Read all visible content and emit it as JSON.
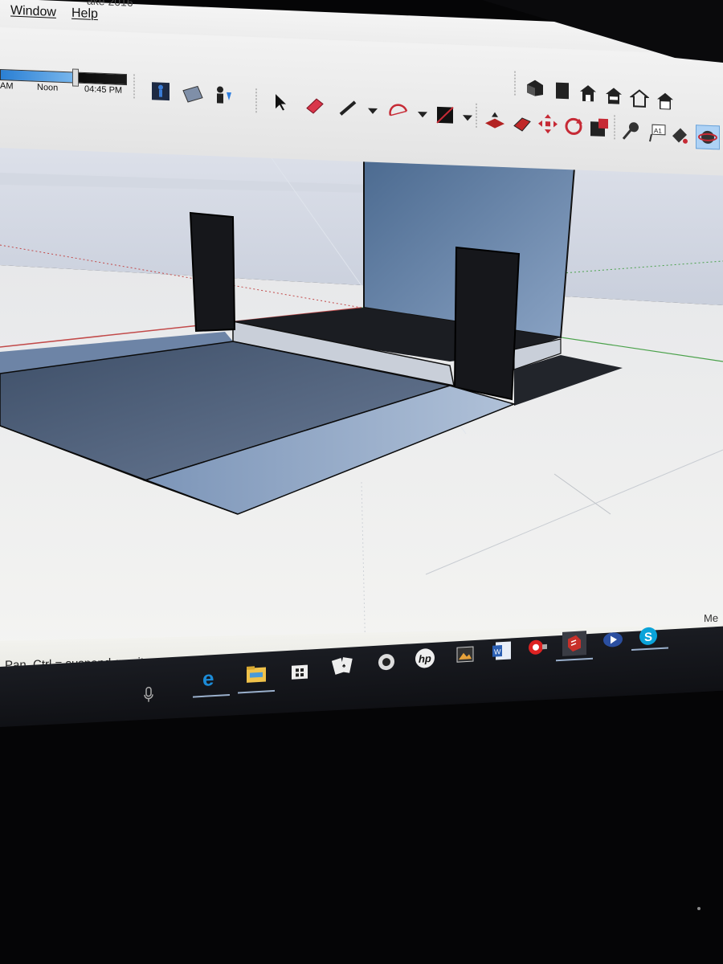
{
  "app": {
    "title_fragment": "ake 2016"
  },
  "menu": {
    "window": "Window",
    "help": "Help"
  },
  "shadow": {
    "label_am": "AM",
    "label_noon": "Noon",
    "time": "04:45 PM"
  },
  "toolbar_icons": {
    "row1": [
      "walk-icon",
      "section-plane-icon",
      "position-camera-icon",
      "select-icon",
      "eraser-icon",
      "pencil-icon",
      "arc-icon",
      "shapes-icon",
      "push-pull-icon",
      "move-icon",
      "rotate-icon",
      "scale-icon",
      "tape-measure-icon",
      "text-icon",
      "paint-bucket-icon",
      "orbit-icon"
    ],
    "views": [
      "iso-view-icon",
      "top-view-icon",
      "front-view-icon",
      "right-view-icon",
      "back-view-icon",
      "left-view-icon"
    ]
  },
  "status": {
    "hint": "Pan, Ctrl = suspend gravity.",
    "measurements_label": "Me"
  },
  "taskbar_icons": [
    "microphone-icon",
    "edge-icon",
    "file-explorer-icon",
    "store-icon",
    "solitaire-icon",
    "webcam-icon",
    "hp-icon",
    "photo-app-icon",
    "word-icon",
    "camera-app-icon",
    "sketchup-icon",
    "media-player-icon",
    "skype-icon"
  ],
  "colors": {
    "accent_blue": "#2f7fe0",
    "sketchup_red": "#c8302a",
    "skype_blue": "#0aa3d9",
    "edge_blue": "#1c8bd6"
  }
}
